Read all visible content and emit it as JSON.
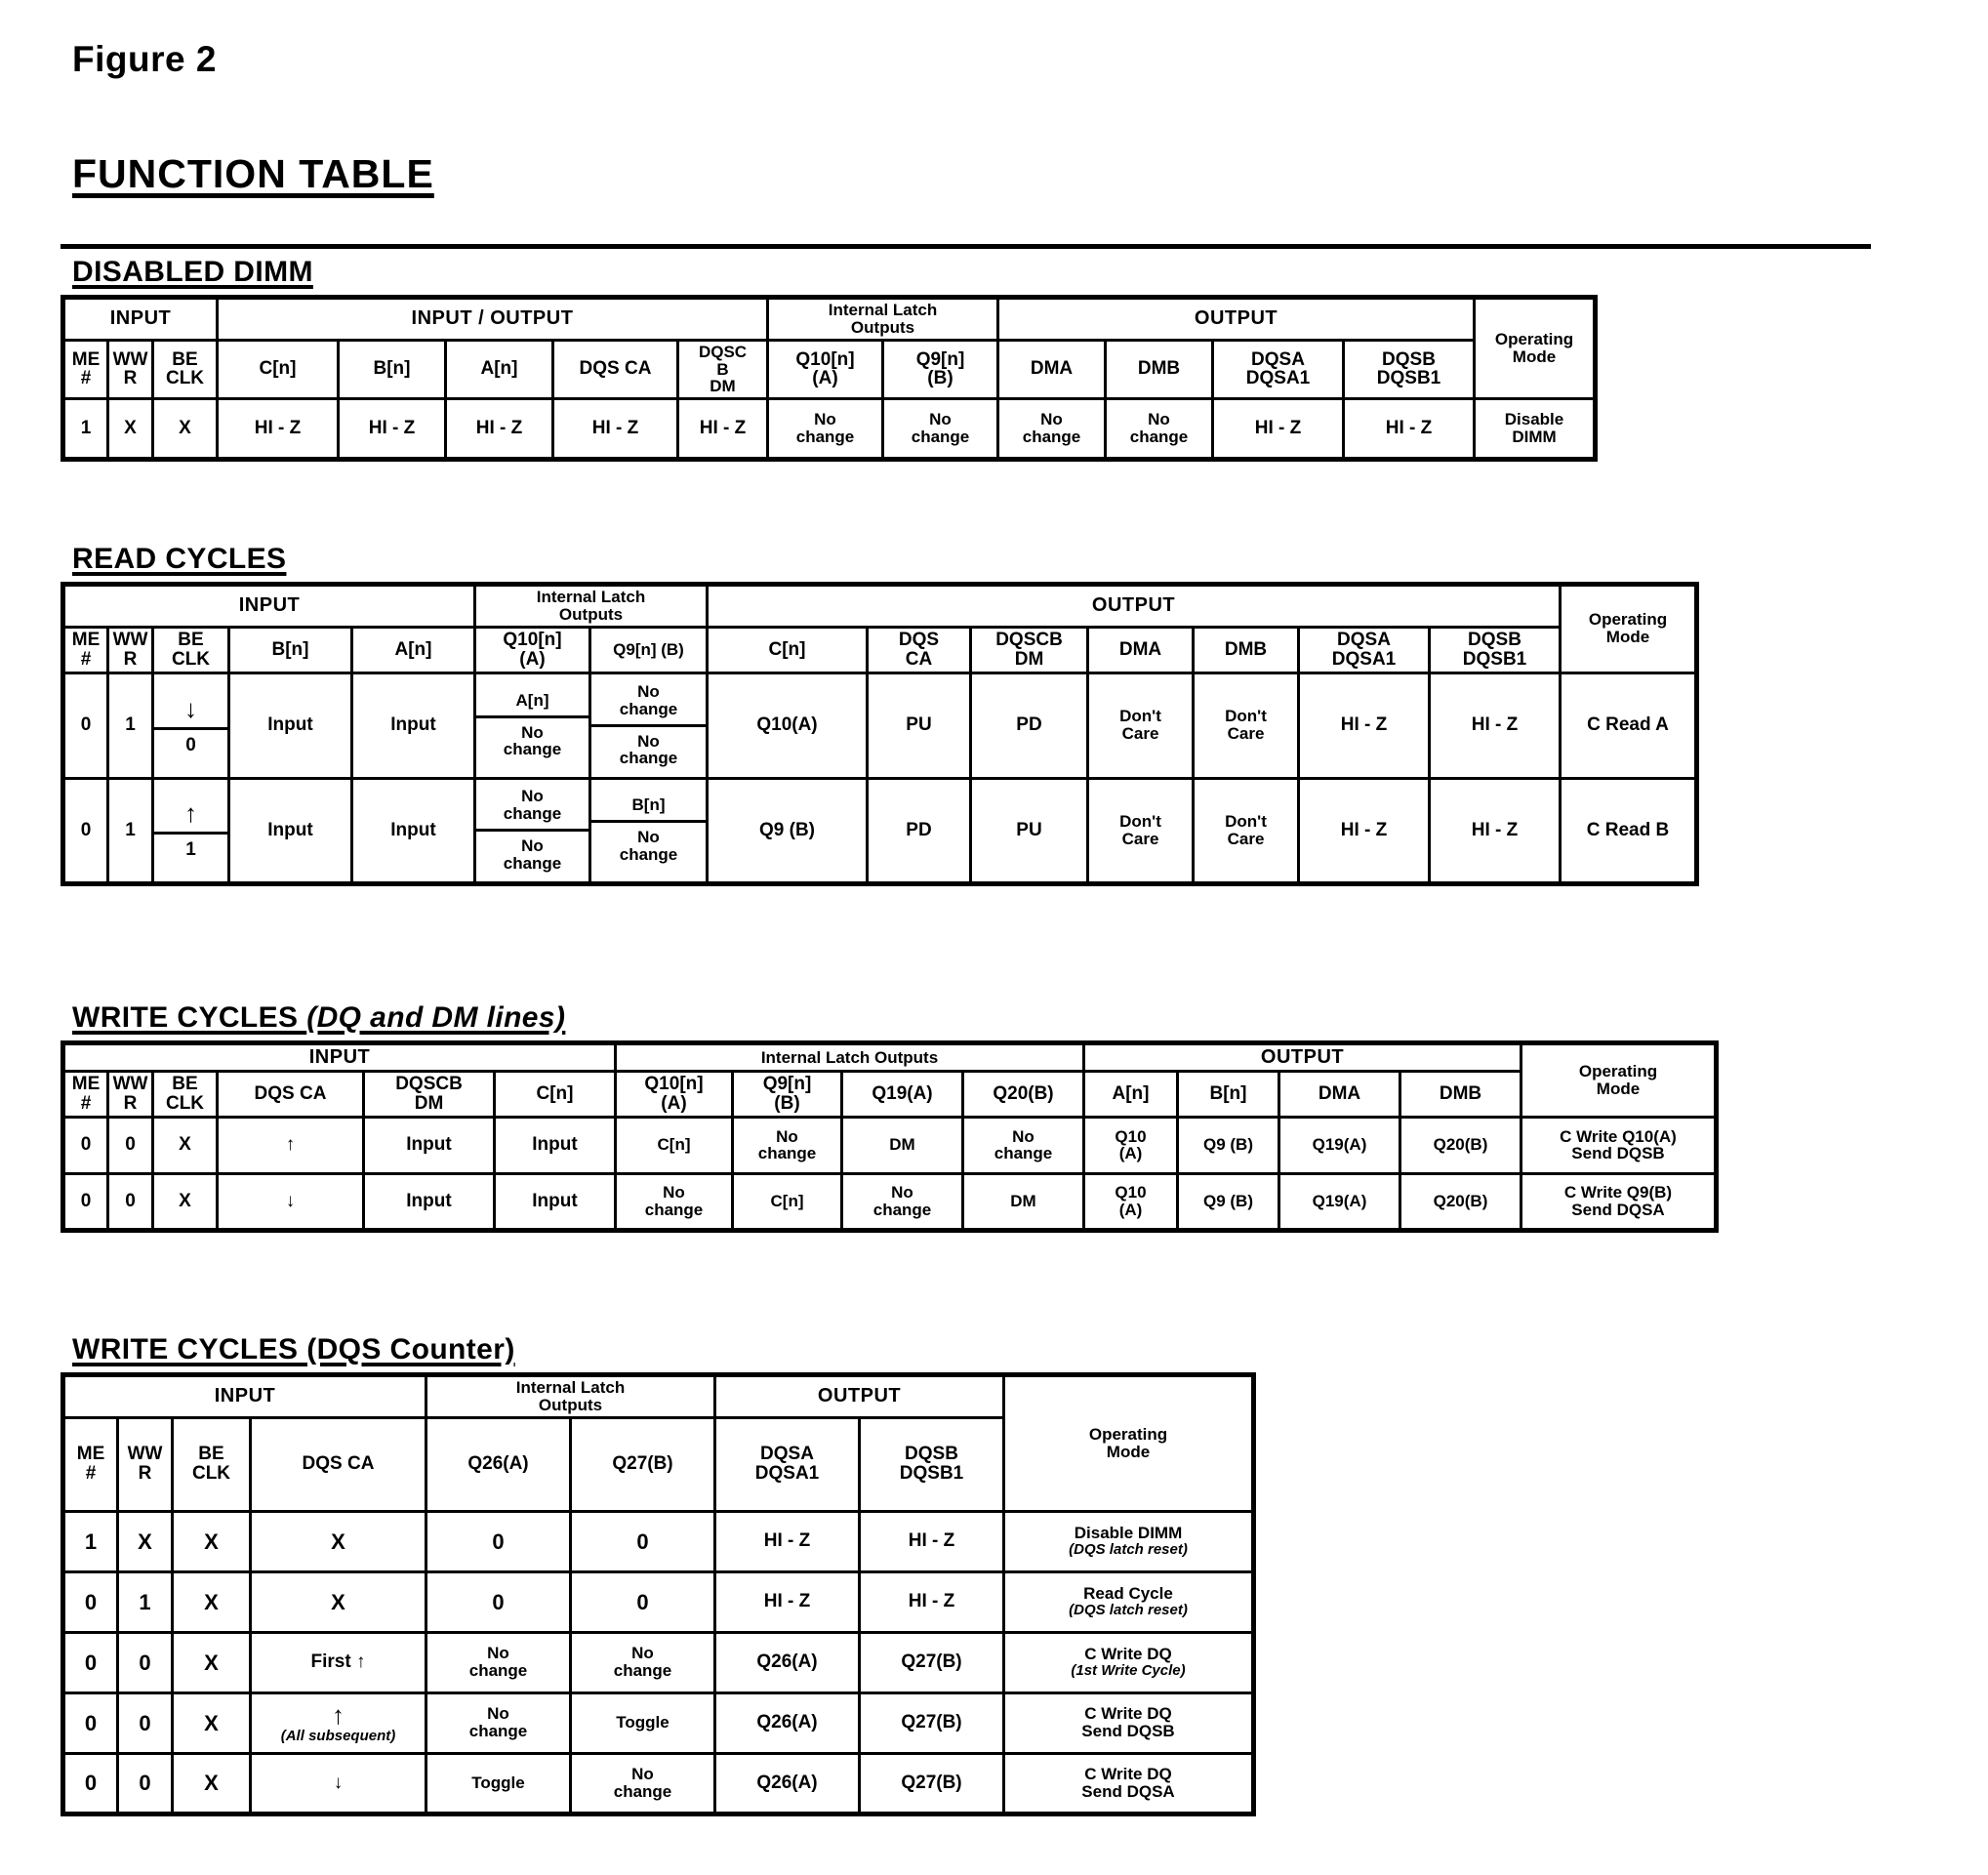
{
  "figure": {
    "label": "Figure 2",
    "title": "FUNCTION TABLE"
  },
  "sections": {
    "disabled_dimm": {
      "title": "DISABLED DIMM",
      "group_headers": {
        "input": "INPUT",
        "input_output": "INPUT / OUTPUT",
        "internal_latch": "Internal Latch\nOutputs",
        "internal_latch_l1": "Internal Latch",
        "internal_latch_l2": "Outputs",
        "output": "OUTPUT",
        "operating_mode_l1": "Operating",
        "operating_mode_l2": "Mode"
      },
      "columns": [
        {
          "l1": "ME",
          "l2": "#"
        },
        {
          "l1": "WW",
          "l2": "R"
        },
        {
          "l1": "BE",
          "l2": "CLK"
        },
        {
          "l1": "C[n]",
          "l2": ""
        },
        {
          "l1": "B[n]",
          "l2": ""
        },
        {
          "l1": "A[n]",
          "l2": ""
        },
        {
          "l1": "DQS CA",
          "l2": ""
        },
        {
          "l1": "DQSC",
          "l2": "B",
          "l3": "DM"
        },
        {
          "l1": "Q10[n]",
          "l2": "(A)"
        },
        {
          "l1": "Q9[n]",
          "l2": "(B)"
        },
        {
          "l1": "DMA",
          "l2": ""
        },
        {
          "l1": "DMB",
          "l2": ""
        },
        {
          "l1": "DQSA",
          "l2": "DQSA1"
        },
        {
          "l1": "DQSB",
          "l2": "DQSB1"
        }
      ],
      "rows": [
        {
          "cells": [
            "1",
            "X",
            "X",
            "HI - Z",
            "HI - Z",
            "HI - Z",
            "HI - Z",
            "HI - Z",
            "No\nchange",
            "No\nchange",
            "No\nchange",
            "No\nchange",
            "HI - Z",
            "HI - Z"
          ],
          "mode_l1": "Disable",
          "mode_l2": "DIMM"
        }
      ]
    },
    "read_cycles": {
      "title": "READ CYCLES",
      "group_headers": {
        "input": "INPUT",
        "internal_latch_l1": "Internal Latch",
        "internal_latch_l2": "Outputs",
        "output": "OUTPUT",
        "operating_mode_l1": "Operating",
        "operating_mode_l2": "Mode"
      },
      "columns": [
        {
          "l1": "ME",
          "l2": "#"
        },
        {
          "l1": "WW",
          "l2": "R"
        },
        {
          "l1": "BE",
          "l2": "CLK"
        },
        {
          "l1": "B[n]",
          "l2": ""
        },
        {
          "l1": "A[n]",
          "l2": ""
        },
        {
          "l1": "Q10[n]",
          "l2": "(A)"
        },
        {
          "l1": "Q9[n] (B)",
          "l2": ""
        },
        {
          "l1": "C[n]",
          "l2": ""
        },
        {
          "l1": "DQS",
          "l2": "CA"
        },
        {
          "l1": "DQSCB",
          "l2": "DM"
        },
        {
          "l1": "DMA",
          "l2": ""
        },
        {
          "l1": "DMB",
          "l2": ""
        },
        {
          "l1": "DQSA",
          "l2": "DQSA1"
        },
        {
          "l1": "DQSB",
          "l2": "DQSB1"
        }
      ],
      "rows": [
        {
          "me": "0",
          "wr": "1",
          "clk_top": "↓",
          "clk_bottom": "0",
          "bn": "Input",
          "an": "Input",
          "q10_top": "A[n]",
          "q10_bottom": "No\nchange",
          "q9_top": "No\nchange",
          "q9_bottom": "No\nchange",
          "cn": "Q10(A)",
          "dqs_ca": "PU",
          "dqscb_dm": "PD",
          "dma": "Don't\nCare",
          "dmb": "Don't\nCare",
          "dqsa": "HI - Z",
          "dqsb": "HI - Z",
          "mode": "C Read A"
        },
        {
          "me": "0",
          "wr": "1",
          "clk_top": "↑",
          "clk_bottom": "1",
          "bn": "Input",
          "an": "Input",
          "q10_top": "No\nchange",
          "q10_bottom": "No\nchange",
          "q9_top": "B[n]",
          "q9_bottom": "No\nchange",
          "cn": "Q9 (B)",
          "dqs_ca": "PD",
          "dqscb_dm": "PU",
          "dma": "Don't\nCare",
          "dmb": "Don't\nCare",
          "dqsa": "HI - Z",
          "dqsb": "HI - Z",
          "mode": "C Read B"
        }
      ]
    },
    "write_cycles_dq_dm": {
      "title_main": "WRITE CYCLES ",
      "title_italic": "(DQ and DM lines)",
      "group_headers": {
        "input": "INPUT",
        "internal_latch": "Internal Latch Outputs",
        "output": "OUTPUT",
        "operating_mode_l1": "Operating",
        "operating_mode_l2": "Mode"
      },
      "columns": [
        {
          "l1": "ME",
          "l2": "#"
        },
        {
          "l1": "WW",
          "l2": "R"
        },
        {
          "l1": "BE",
          "l2": "CLK"
        },
        {
          "l1": "DQS CA",
          "l2": ""
        },
        {
          "l1": "DQSCB",
          "l2": "DM"
        },
        {
          "l1": "C[n]",
          "l2": ""
        },
        {
          "l1": "Q10[n]",
          "l2": "(A)"
        },
        {
          "l1": "Q9[n]",
          "l2": "(B)"
        },
        {
          "l1": "Q19(A)",
          "l2": ""
        },
        {
          "l1": "Q20(B)",
          "l2": ""
        },
        {
          "l1": "A[n]",
          "l2": ""
        },
        {
          "l1": "B[n]",
          "l2": ""
        },
        {
          "l1": "DMA",
          "l2": ""
        },
        {
          "l1": "DMB",
          "l2": ""
        }
      ],
      "rows": [
        {
          "cells": [
            "0",
            "0",
            "X",
            "↑",
            "Input",
            "Input",
            "C[n]",
            "No\nchange",
            "DM",
            "No\nchange",
            "Q10\n(A)",
            "Q9 (B)",
            "Q19(A)",
            "Q20(B)"
          ],
          "mode_l1": "C Write Q10(A)",
          "mode_l2": "Send DQSB"
        },
        {
          "cells": [
            "0",
            "0",
            "X",
            "↓",
            "Input",
            "Input",
            "No\nchange",
            "C[n]",
            "No\nchange",
            "DM",
            "Q10\n(A)",
            "Q9 (B)",
            "Q19(A)",
            "Q20(B)"
          ],
          "mode_l1": "C Write Q9(B)",
          "mode_l2": "Send DQSA"
        }
      ]
    },
    "write_cycles_dqs_counter": {
      "title": "WRITE CYCLES (DQS Counter)",
      "group_headers": {
        "input": "INPUT",
        "internal_latch_l1": "Internal Latch",
        "internal_latch_l2": "Outputs",
        "output": "OUTPUT",
        "operating_mode_l1": "Operating",
        "operating_mode_l2": "Mode"
      },
      "columns": [
        {
          "l1": "ME",
          "l2": "#"
        },
        {
          "l1": "WW",
          "l2": "R"
        },
        {
          "l1": "BE",
          "l2": "CLK"
        },
        {
          "l1": "DQS CA",
          "l2": ""
        },
        {
          "l1": "Q26(A)",
          "l2": ""
        },
        {
          "l1": "Q27(B)",
          "l2": ""
        },
        {
          "l1": "DQSA",
          "l2": "DQSA1"
        },
        {
          "l1": "DQSB",
          "l2": "DQSB1"
        }
      ],
      "rows": [
        {
          "cells": [
            "1",
            "X",
            "X",
            "X",
            "0",
            "0",
            "HI - Z",
            "HI - Z"
          ],
          "mode_l1": "Disable DIMM",
          "mode_l2": "(DQS latch reset)",
          "mode_l2_italic": true
        },
        {
          "cells": [
            "0",
            "1",
            "X",
            "X",
            "0",
            "0",
            "HI - Z",
            "HI - Z"
          ],
          "mode_l1": "Read Cycle",
          "mode_l2": "(DQS latch reset)",
          "mode_l2_italic": true
        },
        {
          "cells": [
            "0",
            "0",
            "X",
            "First ↑",
            "No\nchange",
            "No\nchange",
            "Q26(A)",
            "Q27(B)"
          ],
          "mode_l1": "C Write DQ",
          "mode_l2": "(1st Write Cycle)",
          "mode_l2_italic": true
        },
        {
          "cells": [
            "0",
            "0",
            "X",
            "↑",
            "No\nchange",
            "Toggle",
            "Q26(A)",
            "Q27(B)"
          ],
          "sub_note": "(All subsequent)",
          "mode_l1": "C Write DQ",
          "mode_l2": "Send DQSB",
          "mode_l2_italic": false
        },
        {
          "cells": [
            "0",
            "0",
            "X",
            "↓",
            "Toggle",
            "No\nchange",
            "Q26(A)",
            "Q27(B)"
          ],
          "mode_l1": "C Write DQ",
          "mode_l2": "Send DQSA",
          "mode_l2_italic": false
        }
      ]
    }
  }
}
